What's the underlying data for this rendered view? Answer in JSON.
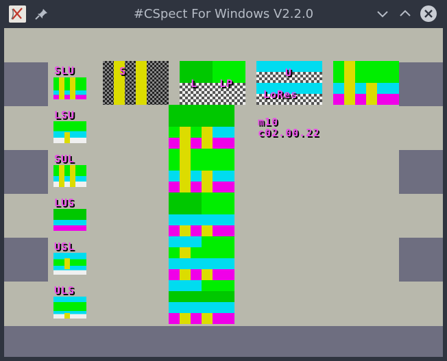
{
  "window": {
    "title": "#CSpect For Windows V2.2.0"
  },
  "icons": {
    "app": "cspect-app-icon",
    "pin": "pin-icon",
    "minimize": "chevron-down-icon",
    "maximize": "chevron-up-icon",
    "close": "close-icon"
  },
  "screen": {
    "colors": {
      "background": "#b8b8ac",
      "border": "#6e6e80",
      "green": "#00ee00",
      "dark_green": "#00c800",
      "cyan": "#00dcf0",
      "magenta": "#f000e8",
      "yellow": "#dcdc00",
      "label": "#e84ae8"
    },
    "layer_labels": [
      "SLU",
      "LSU",
      "SUL",
      "LUS",
      "USL",
      "ULS"
    ],
    "top_labels": {
      "s_box": "S",
      "l_box": "L",
      "lp_box": "LP",
      "u_box": "U",
      "lores_box": "LoRes"
    },
    "info_lines": [
      "m10",
      "c02.00.22"
    ]
  }
}
